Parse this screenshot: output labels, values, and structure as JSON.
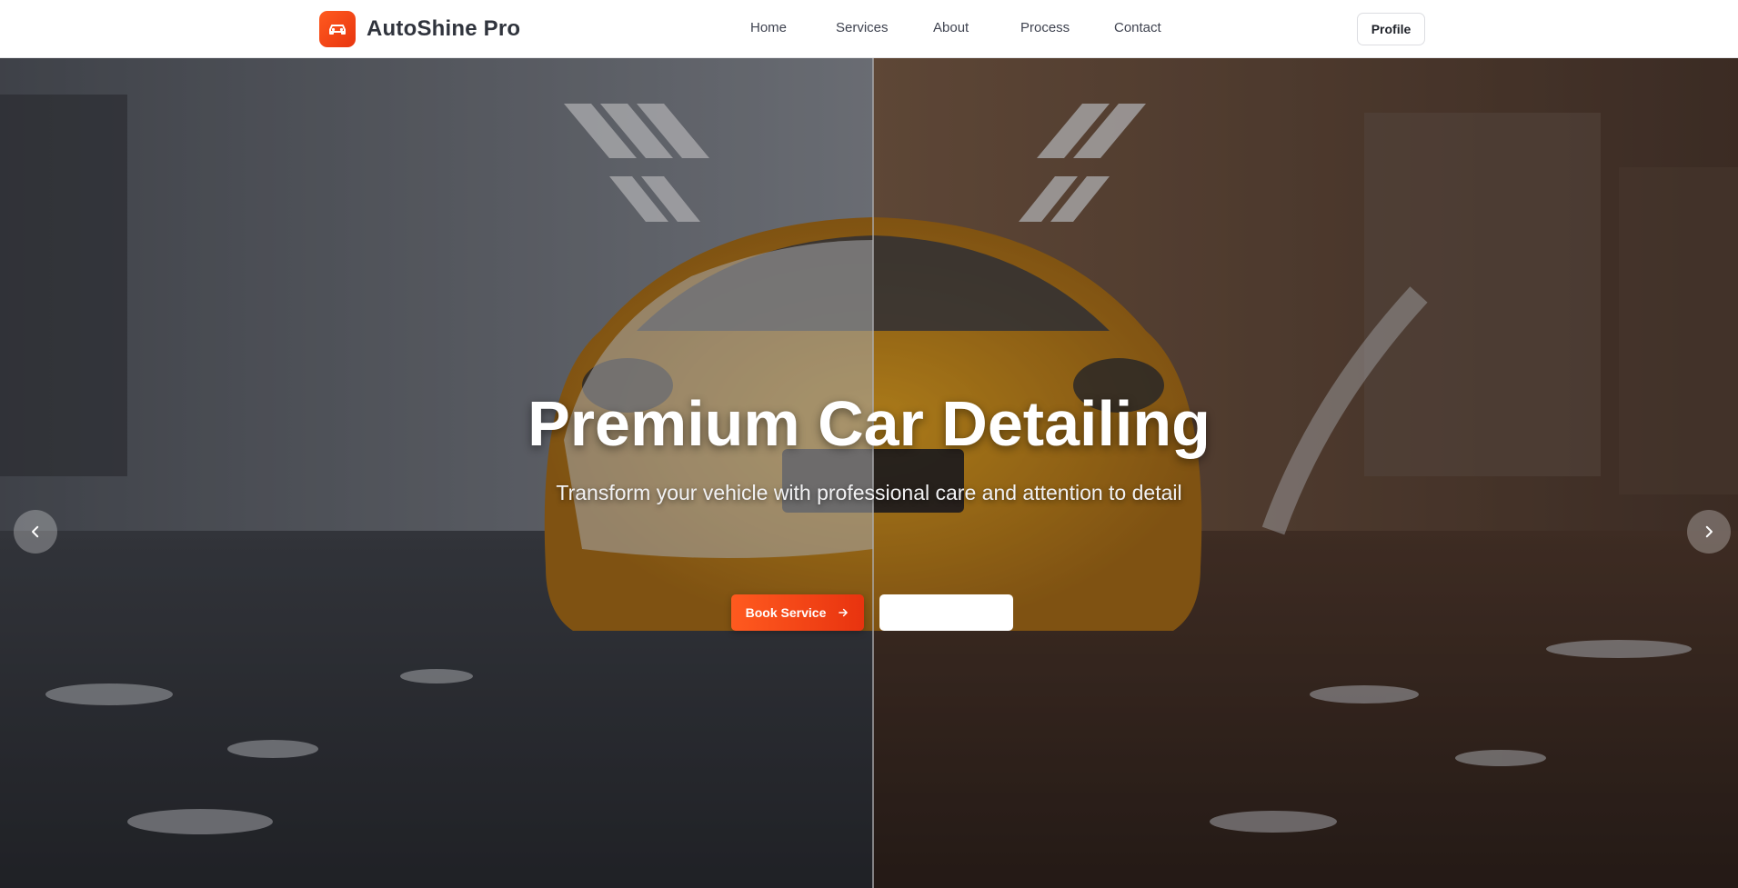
{
  "brand": {
    "name": "AutoShine Pro",
    "logo_icon": "car-icon",
    "accent": "#ff5a1f"
  },
  "nav": {
    "items": [
      {
        "label": "Home"
      },
      {
        "label": "Services"
      },
      {
        "label": "About"
      },
      {
        "label": "Process"
      },
      {
        "label": "Contact"
      }
    ],
    "profile_label": "Profile"
  },
  "hero": {
    "title": "Premium Car Detailing",
    "subtitle": "Transform your vehicle with professional care and attention to detail",
    "primary_button": "Book Service",
    "primary_button_icon": "arrow-right-icon",
    "secondary_button": "",
    "prev_icon": "chevron-left-icon",
    "next_icon": "chevron-right-icon",
    "slides_total": 3,
    "active_slide": 1
  }
}
